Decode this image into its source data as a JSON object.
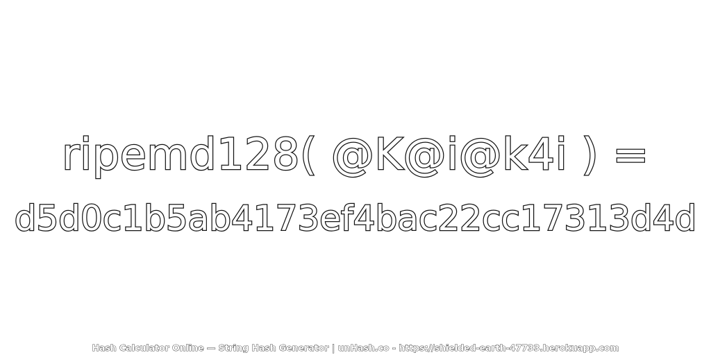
{
  "expression": "ripemd128( @K@i@k4i ) =",
  "hash": "d5d0c1b5ab4173ef4bac22cc17313d4d",
  "footer": "Hash Calculator Online — String Hash Generator | unHash.co - https://shielded-earth-47733.herokuapp.com",
  "colors": {
    "background": "#ffffff",
    "text_fill": "#ffffff",
    "text_outline": "#111111"
  }
}
